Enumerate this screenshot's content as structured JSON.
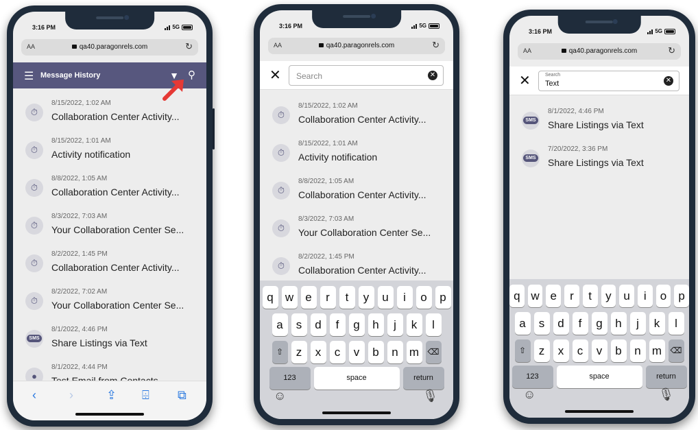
{
  "status": {
    "time": "3:16 PM",
    "network": "5G"
  },
  "browser": {
    "aa_label": "AA",
    "url": "qa40.paragonrels.com"
  },
  "phone1": {
    "header_title": "Message History",
    "messages": [
      {
        "date": "8/15/2022, 1:02 AM",
        "title": "Collaboration Center Activity...",
        "icon": "activity-icon"
      },
      {
        "date": "8/15/2022, 1:01 AM",
        "title": "Activity notification",
        "icon": "activity-icon"
      },
      {
        "date": "8/8/2022, 1:05 AM",
        "title": "Collaboration Center Activity...",
        "icon": "activity-icon"
      },
      {
        "date": "8/3/2022, 7:03 AM",
        "title": "Your Collaboration Center Se...",
        "icon": "activity-icon"
      },
      {
        "date": "8/2/2022, 1:45 PM",
        "title": "Collaboration Center Activity...",
        "icon": "activity-icon"
      },
      {
        "date": "8/2/2022, 7:02 AM",
        "title": "Your Collaboration Center Se...",
        "icon": "activity-icon"
      },
      {
        "date": "8/1/2022, 4:46 PM",
        "title": "Share Listings via Text",
        "icon": "sms-icon"
      },
      {
        "date": "8/1/2022, 4:44 PM",
        "title": "Test Email from Contacts",
        "icon": "person-icon"
      }
    ]
  },
  "phone2": {
    "search_placeholder": "Search",
    "messages": [
      {
        "date": "8/15/2022, 1:02 AM",
        "title": "Collaboration Center Activity..."
      },
      {
        "date": "8/15/2022, 1:01 AM",
        "title": "Activity notification"
      },
      {
        "date": "8/8/2022, 1:05 AM",
        "title": "Collaboration Center Activity..."
      },
      {
        "date": "8/3/2022, 7:03 AM",
        "title": "Your Collaboration Center Se..."
      },
      {
        "date": "8/2/2022, 1:45 PM",
        "title": "Collaboration Center Activity..."
      }
    ]
  },
  "phone3": {
    "search_label": "Search",
    "search_value": "Text",
    "messages": [
      {
        "date": "8/1/2022, 4:46 PM",
        "title": "Share Listings via Text"
      },
      {
        "date": "7/20/2022, 3:36 PM",
        "title": "Share Listings via Text"
      }
    ]
  },
  "sms_badge": "SMS",
  "keyboard": {
    "row1": [
      "q",
      "w",
      "e",
      "r",
      "t",
      "y",
      "u",
      "i",
      "o",
      "p"
    ],
    "row2": [
      "a",
      "s",
      "d",
      "f",
      "g",
      "h",
      "j",
      "k",
      "l"
    ],
    "row3": [
      "z",
      "x",
      "c",
      "v",
      "b",
      "n",
      "m"
    ],
    "numbers": "123",
    "space": "space",
    "return": "return"
  },
  "colors": {
    "app_header": "#57577e",
    "link_blue": "#2a79e0",
    "arrow_red": "#e53935"
  }
}
